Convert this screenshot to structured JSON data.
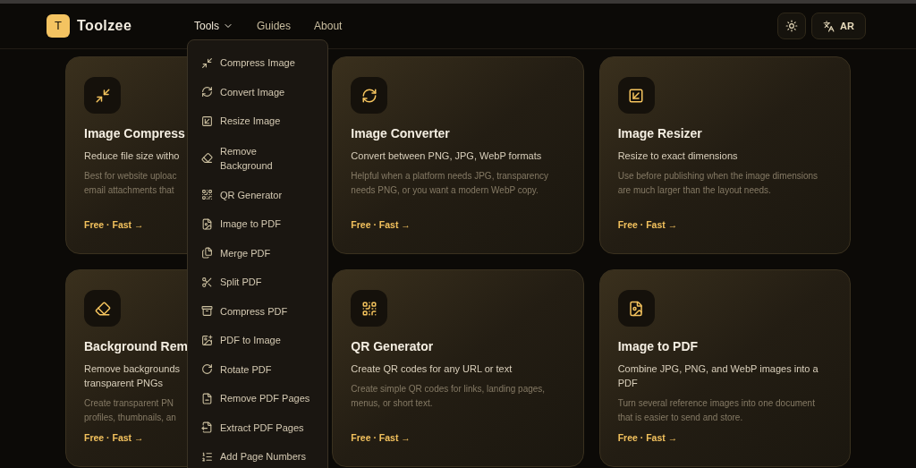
{
  "header": {
    "logo_letter": "T",
    "brand": "Toolzee",
    "nav": [
      {
        "label": "Tools",
        "expanded": true
      },
      {
        "label": "Guides",
        "expanded": false
      },
      {
        "label": "About",
        "expanded": false
      }
    ],
    "language_button": "AR"
  },
  "tools_menu": {
    "items": [
      {
        "label": "Compress Image"
      },
      {
        "label": "Convert Image"
      },
      {
        "label": "Resize Image"
      },
      {
        "label": "Remove Background"
      },
      {
        "label": "QR Generator"
      },
      {
        "label": "Image to PDF"
      },
      {
        "label": "Merge PDF"
      },
      {
        "label": "Split PDF"
      },
      {
        "label": "Compress PDF"
      },
      {
        "label": "PDF to Image"
      },
      {
        "label": "Rotate PDF"
      },
      {
        "label": "Remove PDF Pages"
      },
      {
        "label": "Extract PDF Pages"
      },
      {
        "label": "Add Page Numbers"
      }
    ]
  },
  "cards": [
    {
      "title": "Image Compress",
      "subtitle": "Reduce file size witho",
      "description": "Best for website uploac\nemail attachments that",
      "footer": "Free · Fast →"
    },
    {
      "title": "Image Converter",
      "subtitle": "Convert between PNG, JPG, WebP formats",
      "description": "Helpful when a platform needs JPG, transparency needs PNG, or you want a modern WebP copy.",
      "footer": "Free · Fast →"
    },
    {
      "title": "Image Resizer",
      "subtitle": "Resize to exact dimensions",
      "description": "Use before publishing when the image dimensions are much larger than the layout needs.",
      "footer": "Free · Fast →"
    },
    {
      "title": "Background Rem",
      "subtitle": "Remove backgrounds\ntransparent PNGs",
      "description": "Create transparent PN\nprofiles, thumbnails, an",
      "footer": "Free · Fast →"
    },
    {
      "title": "QR Generator",
      "subtitle": "Create QR codes for any URL or text",
      "description": "Create simple QR codes for links, landing pages, menus, or short text.",
      "footer": "Free · Fast →"
    },
    {
      "title": "Image to PDF",
      "subtitle": "Combine JPG, PNG, and WebP images into a PDF",
      "description": "Turn several reference images into one document that is easier to send and store.",
      "footer": "Free · Fast →"
    }
  ]
}
